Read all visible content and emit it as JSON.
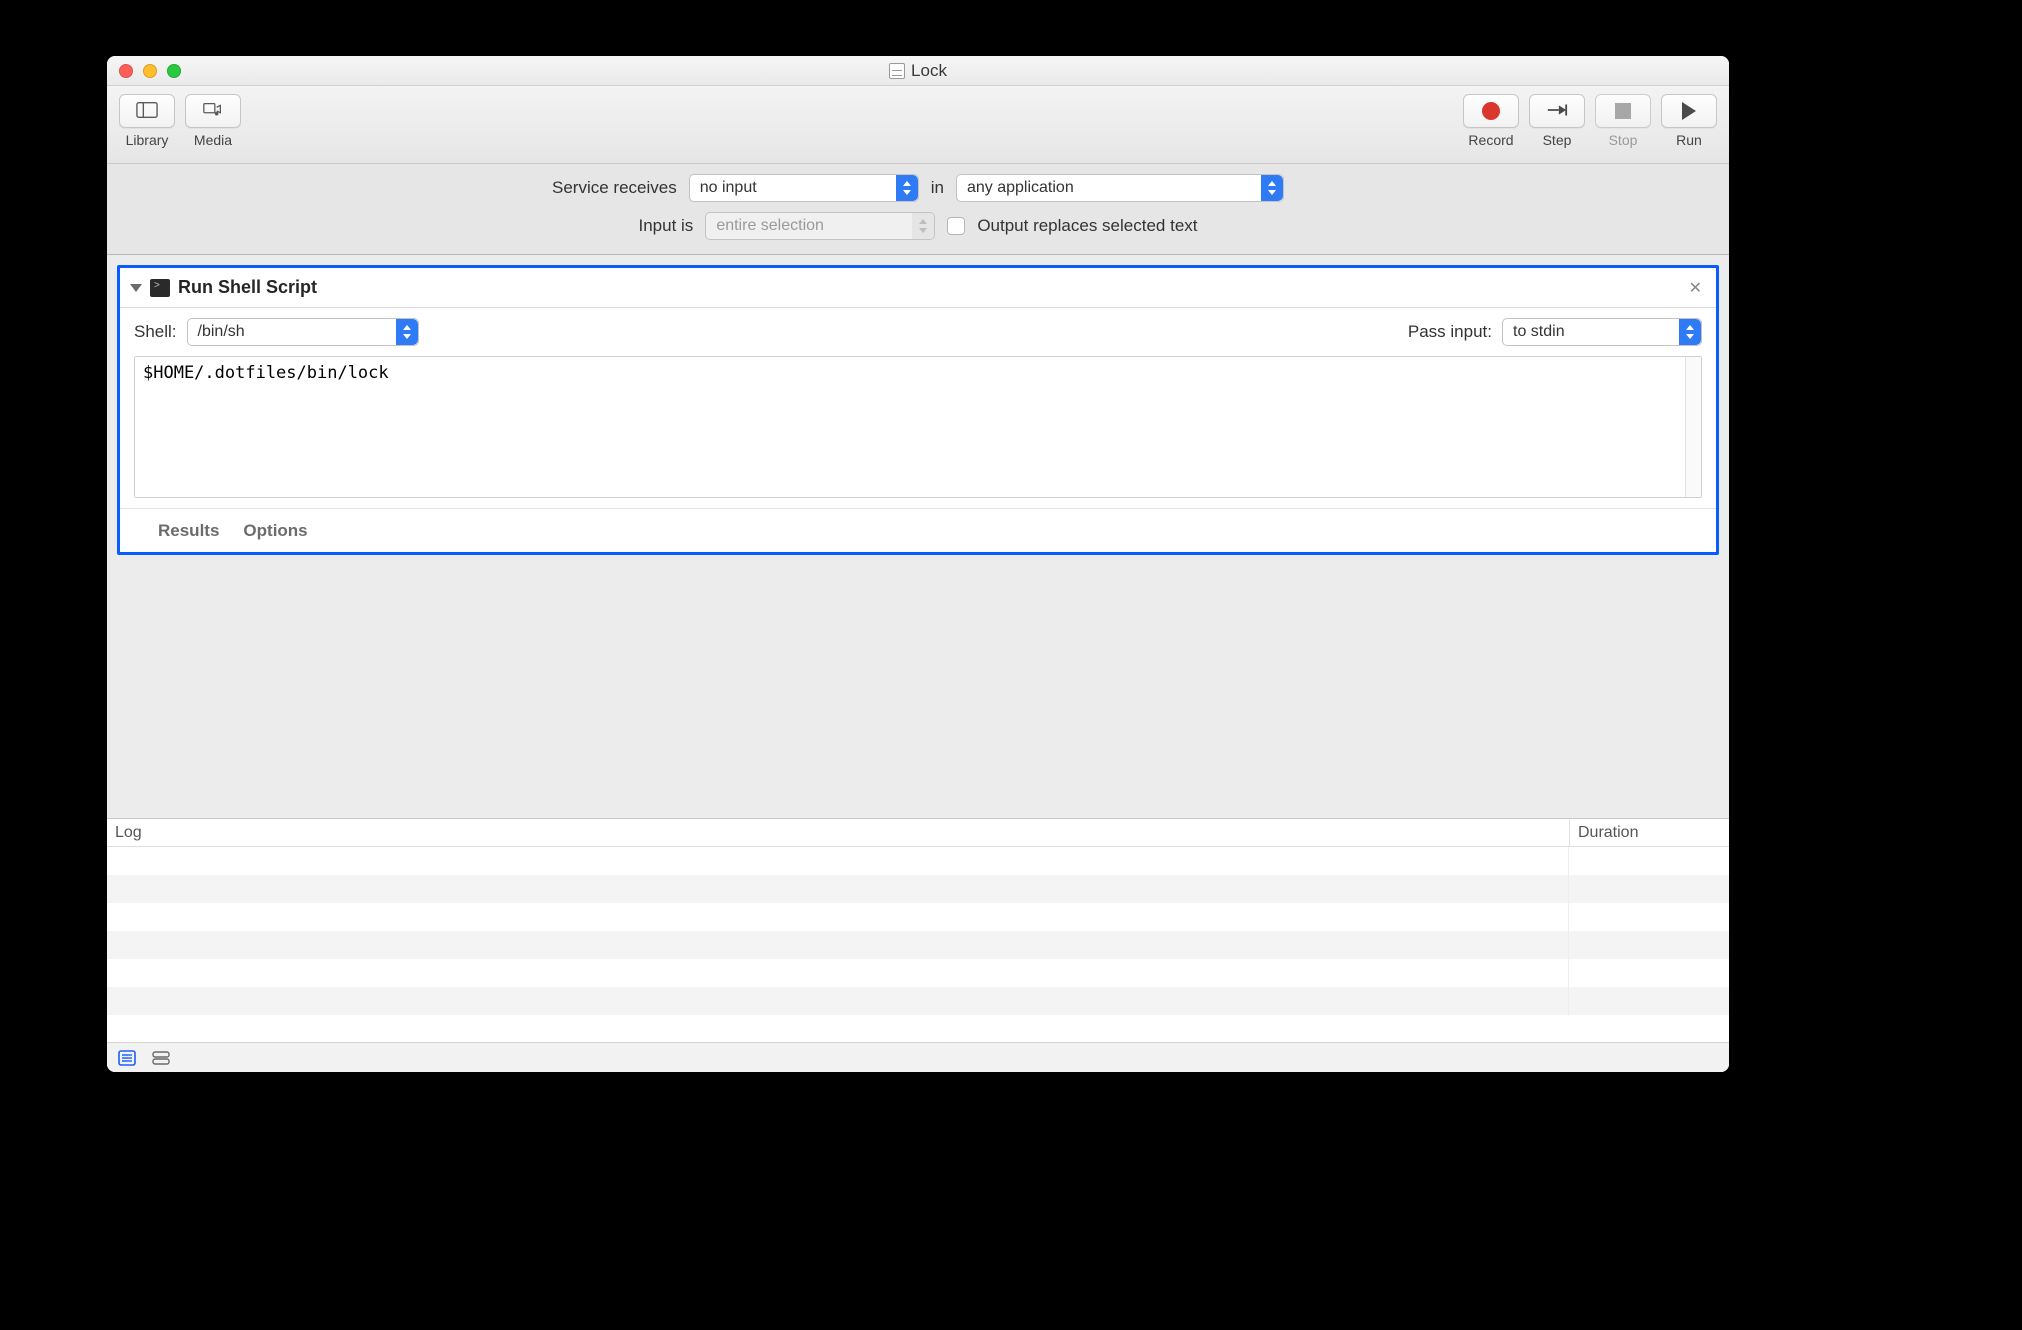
{
  "window": {
    "title": "Lock"
  },
  "toolbar": {
    "library": "Library",
    "media": "Media",
    "record": "Record",
    "step": "Step",
    "stop": "Stop",
    "run": "Run"
  },
  "config": {
    "service_receives_label": "Service receives",
    "service_receives_value": "no input",
    "in_label": "in",
    "in_value": "any application",
    "input_is_label": "Input is",
    "input_is_value": "entire selection",
    "output_replaces_label": "Output replaces selected text",
    "output_replaces_checked": false
  },
  "action": {
    "title": "Run Shell Script",
    "shell_label": "Shell:",
    "shell_value": "/bin/sh",
    "pass_input_label": "Pass input:",
    "pass_input_value": "to stdin",
    "script": "$HOME/.dotfiles/bin/lock",
    "footer_results": "Results",
    "footer_options": "Options"
  },
  "log": {
    "col_log": "Log",
    "col_duration": "Duration"
  }
}
